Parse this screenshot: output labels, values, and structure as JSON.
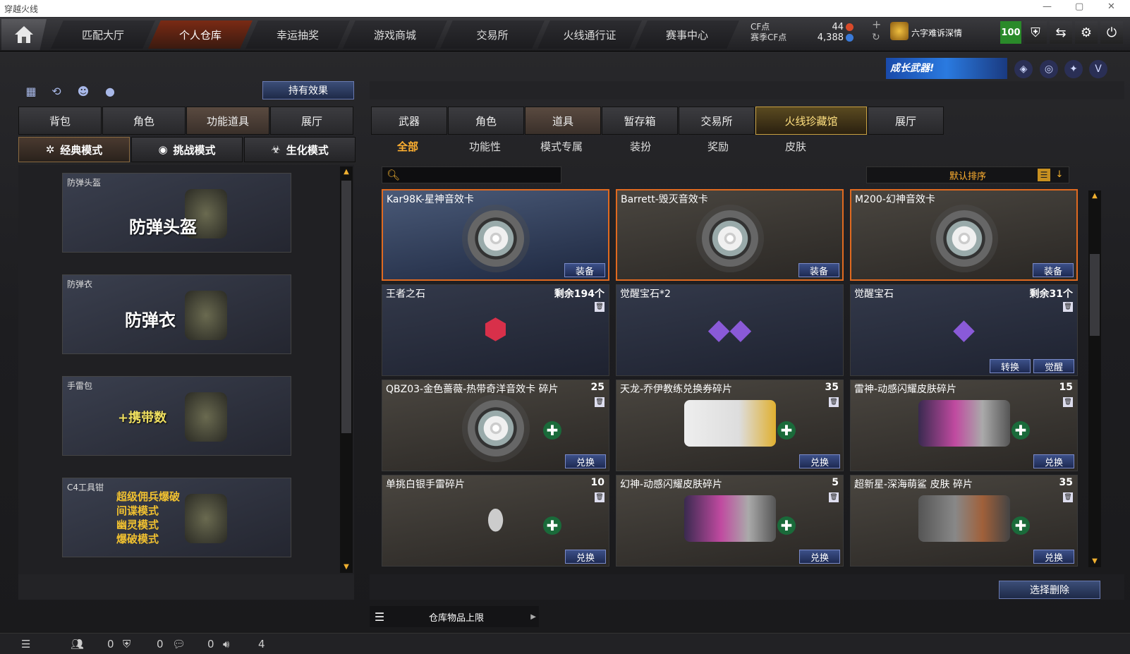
{
  "window": {
    "title": "穿越火线",
    "controls": [
      "—",
      "▢",
      "✕"
    ]
  },
  "topnav": {
    "tabs": [
      "匹配大厅",
      "个人仓库",
      "幸运抽奖",
      "游戏商城",
      "交易所",
      "火线通行证",
      "赛事中心"
    ],
    "active_tab": "个人仓库",
    "cf_label": "CF点",
    "season_cf_label": "赛季CF点",
    "cf_value": "44",
    "season_cf_value": "4,388",
    "player_name": "六字难诉深情",
    "level": "100"
  },
  "banner": {
    "text": "成长武器!"
  },
  "left": {
    "hold_effect_button": "持有效果",
    "tabs": [
      "背包",
      "角色",
      "功能道具",
      "展厅"
    ],
    "active_tab": "功能道具",
    "modes": [
      "经典模式",
      "挑战模式",
      "生化模式"
    ],
    "active_mode": "经典模式",
    "cards": [
      {
        "label": "防弹头盔",
        "big": "防弹头盔"
      },
      {
        "label": "防弹衣",
        "big": "防弹衣"
      },
      {
        "label": "手雷包",
        "big": "+携带数"
      },
      {
        "label": "C4工具钳",
        "lines": [
          "超级佣兵爆破",
          "间谍模式",
          "幽灵模式",
          "爆破模式"
        ]
      }
    ]
  },
  "right": {
    "tabs": [
      "武器",
      "角色",
      "道具",
      "暂存箱",
      "交易所",
      "火线珍藏馆",
      "展厅"
    ],
    "active_tab": "道具",
    "gold_tab": "火线珍藏馆",
    "subtabs": [
      "全部",
      "功能性",
      "模式专属",
      "装扮",
      "奖励",
      "皮肤"
    ],
    "active_subtab": "全部",
    "search_placeholder": "",
    "sort_label": "默认排序",
    "items": [
      {
        "name": "Kar98K-星神音效卡",
        "count": "",
        "action": "装备",
        "kind": "disc"
      },
      {
        "name": "Barrett-毁灭音效卡",
        "count": "",
        "action": "装备",
        "kind": "disc"
      },
      {
        "name": "M200-幻神音效卡",
        "count": "",
        "action": "装备",
        "kind": "disc"
      },
      {
        "name": "王者之石",
        "count": "剩余194个",
        "action": "",
        "kind": "ruby"
      },
      {
        "name": "觉醒宝石*2",
        "count": "",
        "action": "",
        "kind": "gem2"
      },
      {
        "name": "觉醒宝石",
        "count": "剩余31个",
        "action": "觉醒",
        "action2": "转换",
        "kind": "gem"
      },
      {
        "name": "QBZ03-金色蔷薇-热带奇洋音效卡 碎片",
        "count": "25",
        "action": "兑换",
        "kind": "disc"
      },
      {
        "name": "天龙-乔伊教练兑换券碎片",
        "count": "35",
        "action": "兑换",
        "kind": "ticket"
      },
      {
        "name": "雷神-动感闪耀皮肤碎片",
        "count": "15",
        "action": "兑换",
        "kind": "skin"
      },
      {
        "name": "单挑白银手雷碎片",
        "count": "10",
        "action": "兑换",
        "kind": "grenade"
      },
      {
        "name": "幻神-动感闪耀皮肤碎片",
        "count": "5",
        "action": "兑换",
        "kind": "skin"
      },
      {
        "name": "超新星-深海萌鲨 皮肤 碎片",
        "count": "35",
        "action": "兑换",
        "kind": "skin2"
      }
    ],
    "delete_button": "选择删除",
    "capacity_label": "仓库物品上限"
  },
  "statusbar": {
    "values": [
      "0",
      "0",
      "0",
      "4"
    ]
  }
}
